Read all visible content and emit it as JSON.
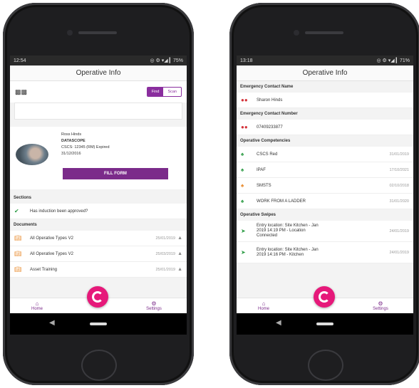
{
  "left": {
    "status": {
      "time": "12:54",
      "icons": "◎ ⚙ ▾◢ ▎75%"
    },
    "title": "Operative Info",
    "segment": {
      "option1": "Find",
      "option2": "Scan"
    },
    "profile": {
      "name": "Ross Hinds",
      "company": "DATASCOPE",
      "card_line1": "CSCS: 12345 (RM) Expired",
      "card_line2": "31/12/2016",
      "button": "FILL FORM"
    },
    "section_sections": "Sections",
    "sections_row": "Has induction been approved?",
    "section_documents": "Documents",
    "documents": [
      {
        "name": "All Operative Types V2",
        "date": "25/01/2019"
      },
      {
        "name": "All Operative Types V2",
        "date": "25/03/2019"
      },
      {
        "name": "Asset Training",
        "date": "25/01/2019"
      }
    ],
    "tabs": {
      "home": "Home",
      "settings": "Settings"
    }
  },
  "right": {
    "status": {
      "time": "13:18",
      "icons": "◎ ⚙ ▾◢ ▎71%"
    },
    "title": "Operative Info",
    "emergency_name_hdr": "Emergency Contact Name",
    "emergency_name": "Sharon Hinds",
    "emergency_number_hdr": "Emergency Contact Number",
    "emergency_number": "07409233877",
    "competencies_hdr": "Operative Competencies",
    "competencies": [
      {
        "name": "CSCS Red",
        "date": "31/01/2019",
        "tone": "green"
      },
      {
        "name": "IPAF",
        "date": "17/10/2021",
        "tone": "green"
      },
      {
        "name": "SMSTS",
        "date": "02/10/2018",
        "tone": "orange"
      },
      {
        "name": "WORK FROM A LADDER",
        "date": "31/01/2020",
        "tone": "green"
      }
    ],
    "swipes_hdr": "Operative Swipes",
    "swipes": [
      {
        "line1": "Entry location: Site Kitchen - Jan",
        "line2": "2019 14:19 PM - Location",
        "line3": "Connected",
        "date": "24/01/2019"
      },
      {
        "line1": "Entry location: Site Kitchen - Jan",
        "line2": "2019 14:16 PM - Kitchen",
        "line3": "",
        "date": "24/01/2019"
      }
    ],
    "tabs": {
      "home": "Home",
      "settings": "Settings"
    }
  }
}
